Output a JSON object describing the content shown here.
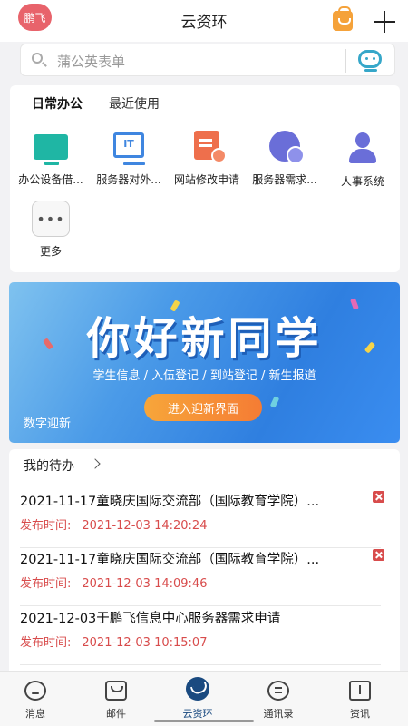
{
  "header": {
    "avatar_text": "鹏飞",
    "title": "云资环"
  },
  "search": {
    "placeholder": "蒲公英表单"
  },
  "office": {
    "tabs": [
      "日常办公",
      "最近使用"
    ],
    "apps": [
      {
        "label": "办公设备借...",
        "icon": "monitor-icon"
      },
      {
        "label": "服务器对外...",
        "icon": "it-icon"
      },
      {
        "label": "网站修改申请",
        "icon": "form-icon"
      },
      {
        "label": "服务器需求...",
        "icon": "globe-icon"
      },
      {
        "label": "人事系统",
        "icon": "person-icon"
      },
      {
        "label": "更多",
        "icon": "more-icon"
      }
    ]
  },
  "banner": {
    "title": "你好新同学",
    "subtitle": "学生信息 / 入伍登记 / 到站登记 / 新生报道",
    "button": "进入迎新界面",
    "caption": "数字迎新"
  },
  "todo": {
    "heading": "我的待办",
    "time_prefix": "发布时间:",
    "items": [
      {
        "title": "2021-11-17童晓庆国际交流部（国际教育学院）...",
        "time": "2021-12-03 14:20:24"
      },
      {
        "title": "2021-11-17童晓庆国际交流部（国际教育学院）...",
        "time": "2021-12-03 14:09:46"
      },
      {
        "title": "2021-12-03于鹏飞信息中心服务器需求申请",
        "time": "2021-12-03 10:15:07"
      }
    ]
  },
  "tabbar": {
    "items": [
      {
        "label": "消息",
        "icon": "message-icon"
      },
      {
        "label": "邮件",
        "icon": "mail-icon"
      },
      {
        "label": "云资环",
        "icon": "brand-icon",
        "active": true
      },
      {
        "label": "通讯录",
        "icon": "contacts-icon"
      },
      {
        "label": "资讯",
        "icon": "news-icon"
      }
    ]
  },
  "colors": {
    "accent": "#1a4a80",
    "danger": "#d84c4c",
    "banner_blue": "#2f7fe0",
    "avatar": "#e8636b"
  }
}
